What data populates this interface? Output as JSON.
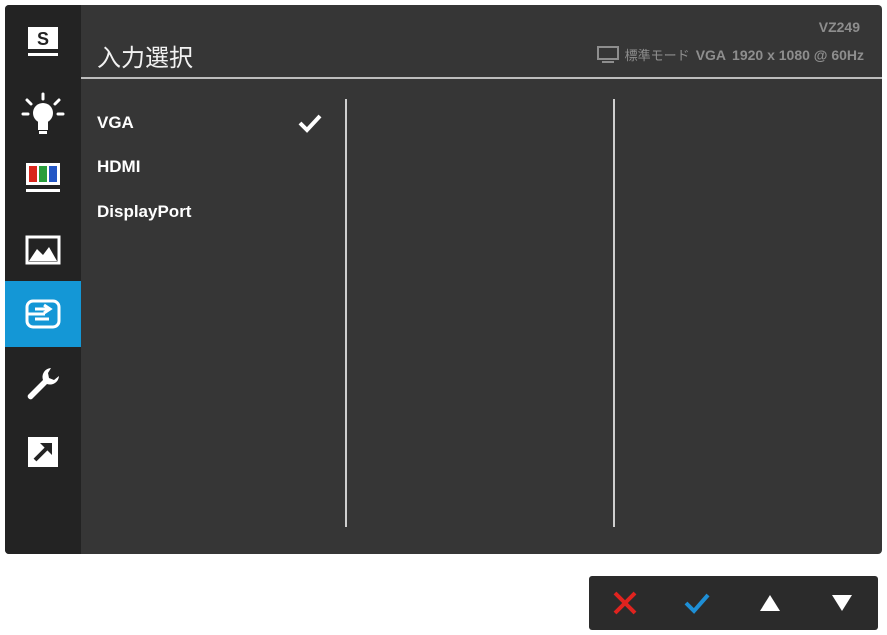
{
  "header": {
    "title": "入力選択",
    "model": "VZ249",
    "mode": "標準モード",
    "signal": "VGA",
    "resolution": "1920 x 1080 @ 60Hz"
  },
  "sidebar": {
    "items": [
      {
        "name": "splendid",
        "icon": "splendid-s-icon",
        "label": "S"
      },
      {
        "name": "blue-light-filter",
        "icon": "bulb-icon"
      },
      {
        "name": "color",
        "icon": "color-bars-icon"
      },
      {
        "name": "image",
        "icon": "mountain-image-icon"
      },
      {
        "name": "input-select",
        "icon": "input-icon",
        "active": true
      },
      {
        "name": "system-setup",
        "icon": "wrench-icon"
      },
      {
        "name": "shortcut",
        "icon": "shortcut-arrow-icon"
      }
    ]
  },
  "options": [
    {
      "label": "VGA",
      "selected": true
    },
    {
      "label": "HDMI",
      "selected": false
    },
    {
      "label": "DisplayPort",
      "selected": false
    }
  ],
  "colors": {
    "panel": "#363636",
    "sidebar": "#232323",
    "active": "#1497d6",
    "close": "#e0231f",
    "confirm": "#1e8fd6"
  },
  "nav": [
    "close-icon",
    "check-icon",
    "up-arrow-icon",
    "down-arrow-icon"
  ]
}
